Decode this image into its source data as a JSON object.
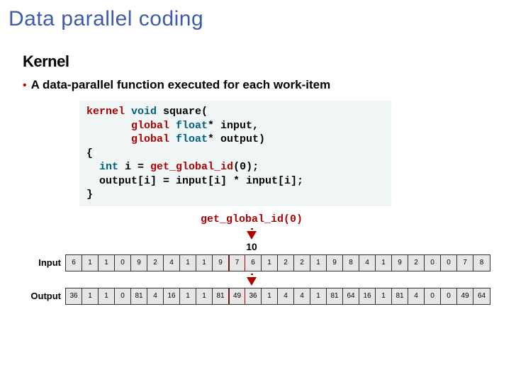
{
  "title": "Data parallel coding",
  "heading": "Kernel",
  "bullet": "A data-parallel function executed for each work-item",
  "code": {
    "l1a": "kernel",
    "l1b": " void",
    "l1c": " square(",
    "l2a": "       global",
    "l2b": " float",
    "l2c": "* input,",
    "l3a": "       global",
    "l3b": " float",
    "l3c": "* output)",
    "l4": "{",
    "l5a": "  int",
    "l5b": " i = ",
    "l5c": "get_global_id",
    "l5d": "(0);",
    "l6": "  output[i] = input[i] * input[i];",
    "l7": "}"
  },
  "diagram": {
    "ggi": "get_global_id(0)",
    "index": "10",
    "input_label": "Input",
    "output_label": "Output",
    "input": [
      "6",
      "1",
      "1",
      "0",
      "9",
      "2",
      "4",
      "1",
      "1",
      "9",
      "7",
      "6",
      "1",
      "2",
      "2",
      "1",
      "9",
      "8",
      "4",
      "1",
      "9",
      "2",
      "0",
      "0",
      "7",
      "8"
    ],
    "output": [
      "36",
      "1",
      "1",
      "0",
      "81",
      "4",
      "16",
      "1",
      "1",
      "81",
      "49",
      "36",
      "1",
      "4",
      "4",
      "1",
      "81",
      "64",
      "16",
      "1",
      "81",
      "4",
      "0",
      "0",
      "49",
      "64"
    ],
    "highlight_index": 10
  }
}
